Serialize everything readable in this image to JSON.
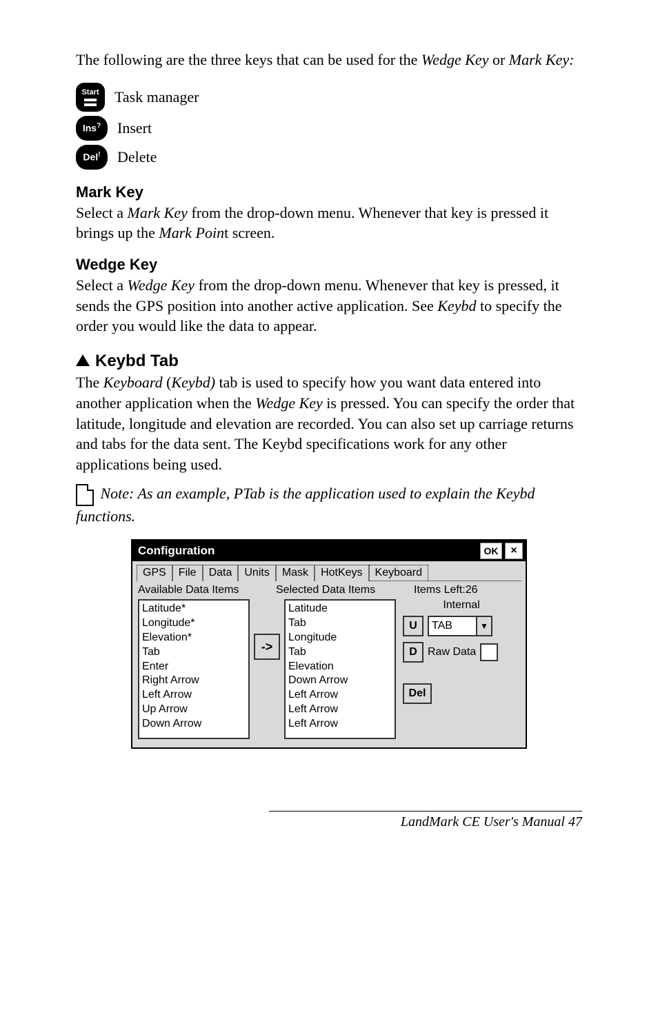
{
  "intro_pre": "The following are the three keys that can be used for the ",
  "intro_wedge": "Wedge Key",
  "intro_or": " or ",
  "intro_mark": "Mark Key:",
  "keys": {
    "start_label": "Start",
    "task_manager": "Task manager",
    "ins_label": "Ins",
    "insert": "Insert",
    "del_label": "Del",
    "delete": "Delete"
  },
  "mark_heading": "Mark Key",
  "mark_para_pre": "Select a ",
  "mark_para_em1": "Mark Key",
  "mark_para_mid": " from the drop-down menu. Whenever that key is pressed it brings up the ",
  "mark_para_em2": "Mark Poin",
  "mark_para_post": "t screen.",
  "wedge_heading": "Wedge Key",
  "wedge_para_pre": "Select a ",
  "wedge_para_em1": "Wedge Key",
  "wedge_para_mid": " from the drop-down menu. Whenever that key is pressed, it sends the GPS position into another active application. See ",
  "wedge_para_em2": "Keybd",
  "wedge_para_post": " to specify the order you would like the data to appear.",
  "keybd_heading": "Keybd Tab",
  "keybd_para_pre": "The ",
  "keybd_para_em1": "Keyboard",
  "keybd_para_paren": " (",
  "keybd_para_em2": "Keybd)",
  "keybd_para_mid": " tab is used to specify how you want data entered into another application when the ",
  "keybd_para_em3": "Wedge Key",
  "keybd_para_post": " is pressed. You can specify the order that latitude, longitude and elevation are recorded. You can also set up carriage returns and tabs for the data sent. The Keybd specifications work for any other applications being used.",
  "note_text": " Note: As an example, PTab is the application used to explain the Keybd functions.",
  "config": {
    "title": "Configuration",
    "ok": "OK",
    "close": "×",
    "tabs": [
      "GPS",
      "File",
      "Data",
      "Units",
      "Mask",
      "HotKeys",
      "Keyboard"
    ],
    "header_available": "Available Data Items",
    "header_selected": "Selected Data Items",
    "header_itemsleft": "Items Left:26",
    "available": [
      "Latitude*",
      "Longitude*",
      "Elevation*",
      "Tab",
      "Enter",
      "Right Arrow",
      "Left Arrow",
      "Up Arrow",
      "Down Arrow"
    ],
    "arrow": "->",
    "selected": [
      "Latitude",
      "Tab",
      "Longitude",
      "Tab",
      "Elevation",
      "Down Arrow",
      "Left Arrow",
      "Left Arrow",
      "Left Arrow"
    ],
    "internal": "Internal",
    "u": "U",
    "tab_value": "TAB",
    "d": "D",
    "raw": "Raw Data",
    "del": "Del"
  },
  "footer": "LandMark CE User's Manual  47"
}
